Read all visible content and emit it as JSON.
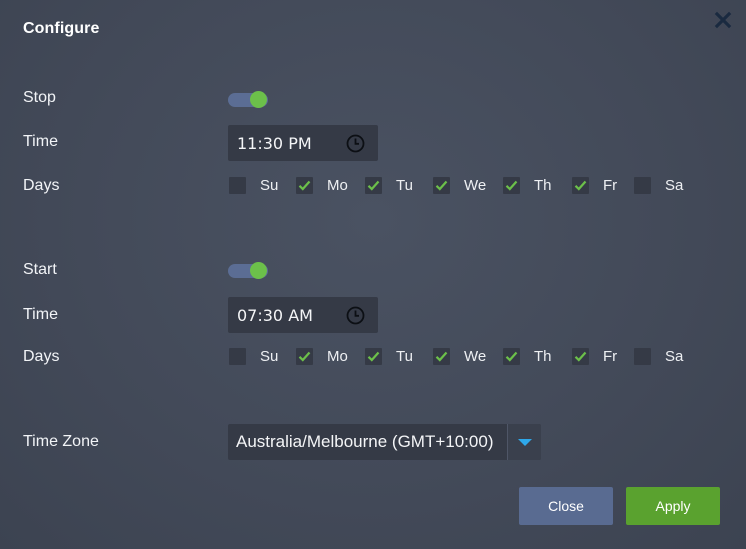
{
  "dialog": {
    "title": "Configure",
    "close_icon": "close-x-icon"
  },
  "stop": {
    "label": "Stop",
    "enabled": true,
    "time_label": "Time",
    "time_value": "11:30 PM",
    "days_label": "Days",
    "days": [
      {
        "label": "Su",
        "checked": false
      },
      {
        "label": "Mo",
        "checked": true
      },
      {
        "label": "Tu",
        "checked": true
      },
      {
        "label": "We",
        "checked": true
      },
      {
        "label": "Th",
        "checked": true
      },
      {
        "label": "Fr",
        "checked": true
      },
      {
        "label": "Sa",
        "checked": false
      }
    ]
  },
  "start": {
    "label": "Start",
    "enabled": true,
    "time_label": "Time",
    "time_value": "07:30 AM",
    "days_label": "Days",
    "days": [
      {
        "label": "Su",
        "checked": false
      },
      {
        "label": "Mo",
        "checked": true
      },
      {
        "label": "Tu",
        "checked": true
      },
      {
        "label": "We",
        "checked": true
      },
      {
        "label": "Th",
        "checked": true
      },
      {
        "label": "Fr",
        "checked": true
      },
      {
        "label": "Sa",
        "checked": false
      }
    ]
  },
  "timezone": {
    "label": "Time Zone",
    "value": "Australia/Melbourne (GMT+10:00)"
  },
  "buttons": {
    "close_label": "Close",
    "apply_label": "Apply"
  },
  "colors": {
    "toggle_on": "#6cc04a",
    "toggle_track": "#5b6d94",
    "check": "#6cc04a",
    "apply": "#5aa22f",
    "close": "#596b91",
    "dropdown_arrow": "#2ea8ea"
  }
}
